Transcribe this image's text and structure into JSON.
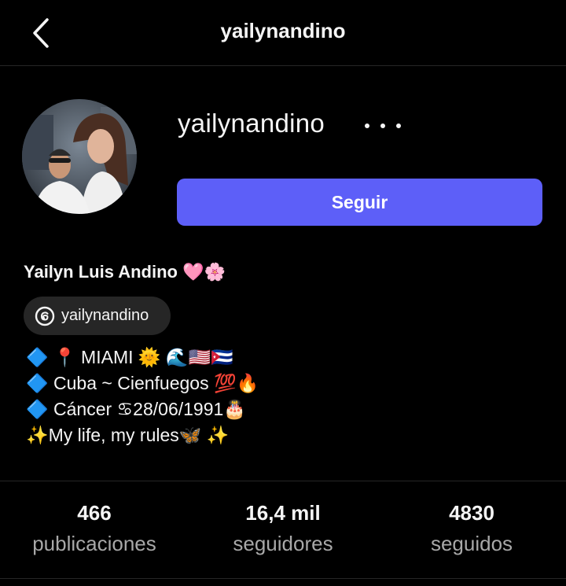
{
  "header": {
    "title": "yailynandino",
    "back_icon": "chevron-left-icon"
  },
  "profile": {
    "username": "yailynandino",
    "follow_label": "Seguir",
    "full_name": "Yailyn Luis Andino 🩷🌸",
    "threads_handle": "yailynandino"
  },
  "bio": [
    "🔷 📍 MIAMI 🌞 🌊🇺🇸🇨🇺",
    "🔷 Cuba ~ Cienfuegos 💯🔥",
    "🔷 Cáncer ♋28/06/1991🎂",
    "✨My life, my rules🦋 ✨"
  ],
  "stats": [
    {
      "value": "466",
      "label": "publicaciones"
    },
    {
      "value": "16,4 mil",
      "label": "seguidores"
    },
    {
      "value": "4830",
      "label": "seguidos"
    }
  ],
  "colors": {
    "background": "#000000",
    "follow_button": "#5d5ff8",
    "secondary_text": "#a8a8a8",
    "chip": "#262626"
  }
}
